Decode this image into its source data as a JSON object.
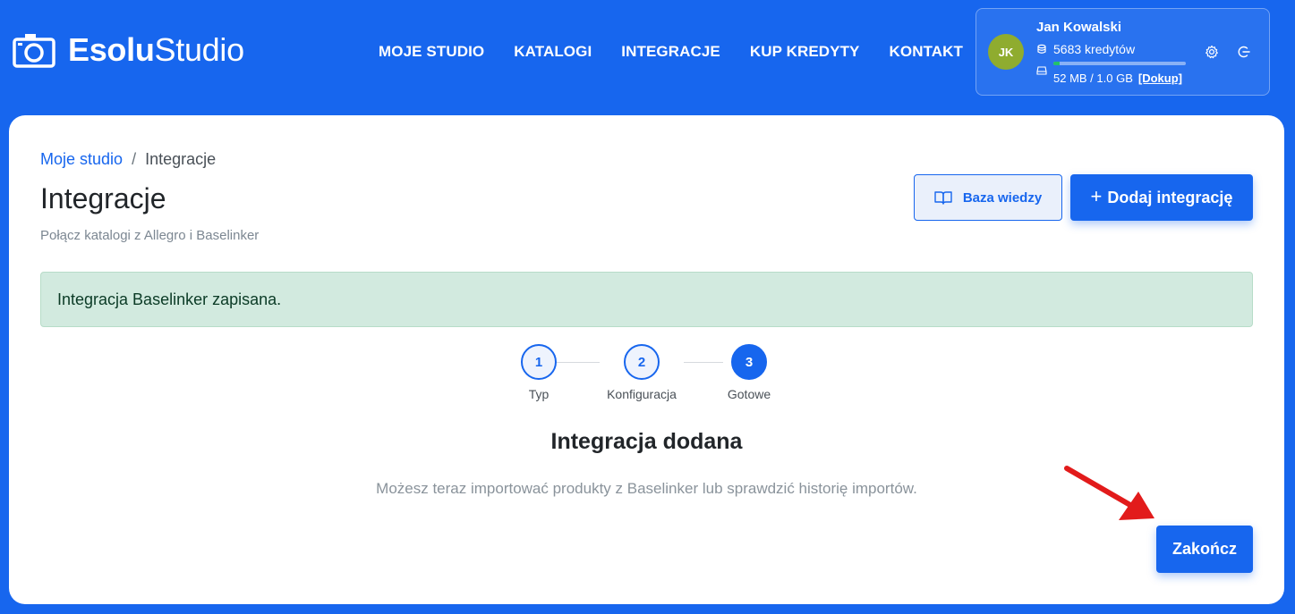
{
  "header": {
    "brand_bold": "Esolu",
    "brand_regular": "Studio",
    "nav": [
      {
        "label": "MOJE STUDIO"
      },
      {
        "label": "KATALOGI"
      },
      {
        "label": "INTEGRACJE"
      },
      {
        "label": "KUP KREDYTY"
      },
      {
        "label": "KONTAKT"
      }
    ]
  },
  "user": {
    "initials": "JK",
    "name": "Jan Kowalski",
    "credits": "5683 kredytów",
    "storage": "52 MB / 1.0 GB",
    "storage_fraction": 0.05,
    "topup": "[Dokup]",
    "avatar_color": "#8fac2f"
  },
  "breadcrumb": {
    "link": "Moje studio",
    "separator": "/",
    "current": "Integracje"
  },
  "page": {
    "title": "Integracje",
    "subtitle": "Połącz katalogi z Allegro i Baselinker"
  },
  "buttons": {
    "knowledge_base": "Baza wiedzy",
    "add_plus": "+",
    "add_integration": "Dodaj integrację",
    "finish": "Zakończ"
  },
  "alert": {
    "message": "Integracja Baselinker zapisana."
  },
  "steps": [
    {
      "number": "1",
      "label": "Typ"
    },
    {
      "number": "2",
      "label": "Konfiguracja"
    },
    {
      "number": "3",
      "label": "Gotowe"
    }
  ],
  "completion": {
    "title": "Integracja dodana",
    "text": "Możesz teraz importować produkty z Baselinker lub sprawdzić historię importów."
  },
  "colors": {
    "primary": "#1766ee",
    "alert_bg": "#d2eadf",
    "annotation_arrow": "#e21b1b"
  }
}
